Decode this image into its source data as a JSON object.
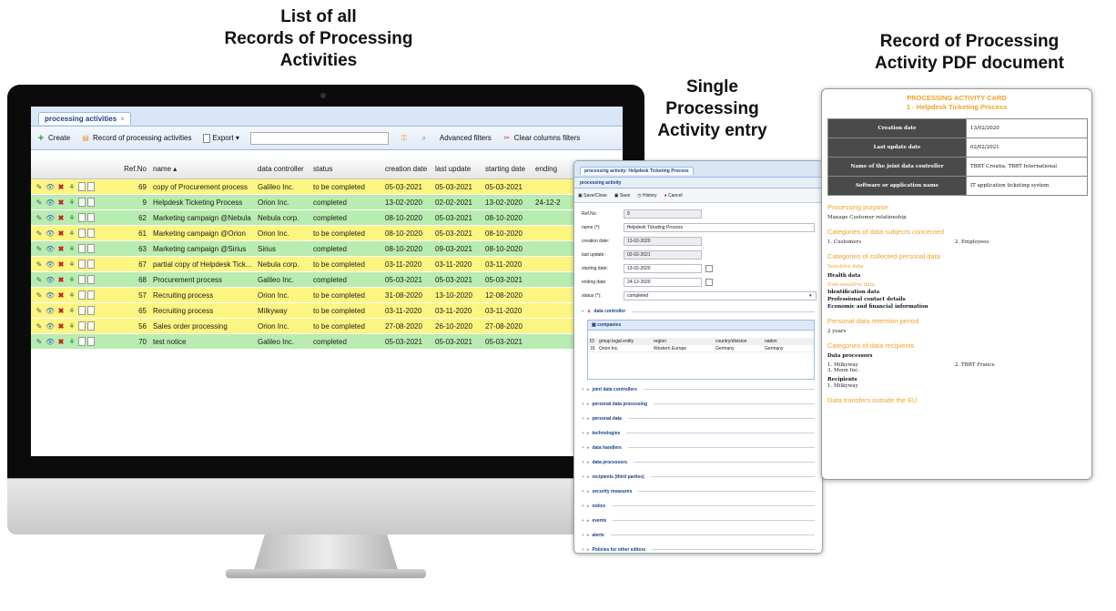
{
  "captions": {
    "list": [
      "List of all",
      "Records of Processing",
      "Activities"
    ],
    "single": [
      "Single",
      "Processing",
      "Activity entry"
    ],
    "pdf": [
      "Record of Processing",
      "Activity PDF document"
    ]
  },
  "list_app": {
    "tab_label": "processing activities",
    "tab_close": "×",
    "toolbar": {
      "create": "Create",
      "record": "Record of processing activities",
      "export": "Export ▾",
      "advanced_filters": "Advanced filters",
      "clear_filters": "Clear columns filters"
    },
    "columns": [
      "Ref.No",
      "name ▴",
      "data controller",
      "status",
      "creation date",
      "last update",
      "starting date",
      "ending"
    ],
    "rows": [
      {
        "ref": "69",
        "name": "copy of Procurement process",
        "controller": "Galileo Inc.",
        "status": "to be completed",
        "created": "05-03-2021",
        "updated": "05-03-2021",
        "start": "05-03-2021",
        "end": "",
        "color": "yellow"
      },
      {
        "ref": "9",
        "name": "Helpdesk Ticketing Process",
        "controller": "Orion Inc.",
        "status": "completed",
        "created": "13-02-2020",
        "updated": "02-02-2021",
        "start": "13-02-2020",
        "end": "24-12-2",
        "color": "green"
      },
      {
        "ref": "62",
        "name": "Marketing campaign @Nebula",
        "controller": "Nebula corp.",
        "status": "completed",
        "created": "08-10-2020",
        "updated": "05-03-2021",
        "start": "08-10-2020",
        "end": "",
        "color": "green"
      },
      {
        "ref": "61",
        "name": "Marketing campaign @Orion",
        "controller": "Orion Inc.",
        "status": "to be completed",
        "created": "08-10-2020",
        "updated": "05-03-2021",
        "start": "08-10-2020",
        "end": "",
        "color": "yellow"
      },
      {
        "ref": "63",
        "name": "Marketing campaign @Sirius",
        "controller": "Sirius",
        "status": "completed",
        "created": "08-10-2020",
        "updated": "09-03-2021",
        "start": "08-10-2020",
        "end": "",
        "color": "green"
      },
      {
        "ref": "67",
        "name": "partial copy of Helpdesk Tick...",
        "controller": "Nebula corp.",
        "status": "to be completed",
        "created": "03-11-2020",
        "updated": "03-11-2020",
        "start": "03-11-2020",
        "end": "",
        "color": "yellow"
      },
      {
        "ref": "68",
        "name": "Procurement process",
        "controller": "Galileo Inc.",
        "status": "completed",
        "created": "05-03-2021",
        "updated": "05-03-2021",
        "start": "05-03-2021",
        "end": "",
        "color": "green"
      },
      {
        "ref": "57",
        "name": "Recruiting process",
        "controller": "Orion Inc.",
        "status": "to be completed",
        "created": "31-08-2020",
        "updated": "13-10-2020",
        "start": "12-08-2020",
        "end": "",
        "color": "yellow"
      },
      {
        "ref": "65",
        "name": "Recruiting process",
        "controller": "Milkyway",
        "status": "to be completed",
        "created": "03-11-2020",
        "updated": "03-11-2020",
        "start": "03-11-2020",
        "end": "",
        "color": "yellow"
      },
      {
        "ref": "56",
        "name": "Sales order processing",
        "controller": "Orion Inc.",
        "status": "to be completed",
        "created": "27-08-2020",
        "updated": "26-10-2020",
        "start": "27-08-2020",
        "end": "",
        "color": "yellow"
      },
      {
        "ref": "70",
        "name": "test notice",
        "controller": "Galileo Inc.",
        "status": "completed",
        "created": "05-03-2021",
        "updated": "05-03-2021",
        "start": "05-03-2021",
        "end": "",
        "color": "green"
      }
    ]
  },
  "entry": {
    "tab_label": "processing activity: Helpdesk Ticketing Process",
    "subtab": "processing activity",
    "toolbar": [
      "Save/Close",
      "Save",
      "History",
      "Cancel"
    ],
    "fields": [
      {
        "label": "Ref.No:",
        "value": "9",
        "readonly": true,
        "cal": false
      },
      {
        "label": "name (*):",
        "value": "Helpdesk Ticketing Process",
        "readonly": false,
        "cal": false
      },
      {
        "label": "creation date:",
        "value": "13-02-2020",
        "readonly": true,
        "cal": false
      },
      {
        "label": "last update:",
        "value": "02-02-2021",
        "readonly": true,
        "cal": false
      },
      {
        "label": "starting date:",
        "value": "13-02-2020",
        "readonly": false,
        "cal": true
      },
      {
        "label": "ending date:",
        "value": "24-12-2020",
        "readonly": false,
        "cal": true
      },
      {
        "label": "status (*):",
        "value": "completed",
        "readonly": false,
        "cal": false
      }
    ],
    "data_controller": "data controller",
    "companies": "companies",
    "companies_columns": [
      "ID",
      "group legal entity",
      "region",
      "country/division",
      "nation"
    ],
    "companies_row": [
      "16",
      "Orion Inc.",
      "Western Europe",
      "Germany",
      "Germany"
    ],
    "sections": [
      "joint data controllers",
      "personal data processing",
      "personal data",
      "technologies",
      "data handlers",
      "data processors",
      "recipients (third parties)",
      "security measures",
      "notice",
      "events",
      "alerts",
      "Policies for other editors"
    ]
  },
  "pdf": {
    "title1": "PROCESSING ACTIVITY CARD",
    "title2": "1 - Helpdesk Ticketing Process",
    "table": [
      [
        "Creation date",
        "13/02/2020"
      ],
      [
        "Last update date",
        "02/02/2021"
      ],
      [
        "Name of the joint data controller",
        "TBBT Croatia, TBBT International"
      ],
      [
        "Software or application name",
        "IT application ticketing system"
      ]
    ],
    "purpose_h": "Processing purpose",
    "purpose": "Manage Customer relationship",
    "subjects_h": "Categories of data subjects concerned",
    "subjects": [
      "1. Customers",
      "2. Employees"
    ],
    "collected_h": "Categories of collected personal data",
    "sensitive_h": "Sensitive data",
    "sensitive": [
      "Health data"
    ],
    "nonsensitive_h": "Non-sensitive data",
    "nonsensitive": [
      "Identification data",
      "Professional contact details",
      "Economic and financial information"
    ],
    "retention_h": "Personal data retention period",
    "retention": "2 years",
    "recipients_h": "Categories of data recipients",
    "processors_h": "Data processors",
    "processors_left": [
      "1. Milkyway",
      "3. Moon Inc."
    ],
    "processors_right": "2. TBBT France",
    "recipients_sub": "Recipients",
    "recipients": [
      "1. Milkyway"
    ],
    "transfers_h": "Data transfers outside the EU"
  }
}
